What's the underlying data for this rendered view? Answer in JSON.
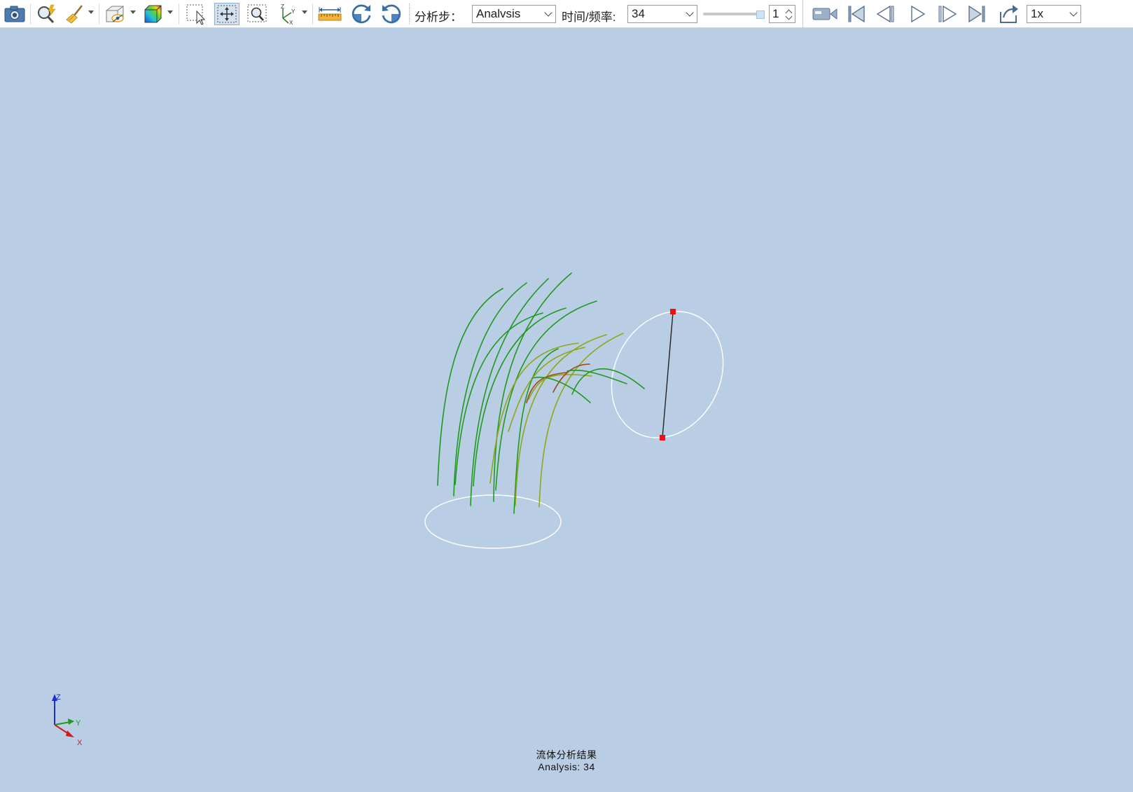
{
  "toolbar": {
    "icons": [
      {
        "name": "camera-icon"
      },
      {
        "name": "query-icon"
      },
      {
        "name": "broom-icon"
      },
      {
        "name": "visibility-icon"
      },
      {
        "name": "contour-icon"
      },
      {
        "name": "select-icon"
      },
      {
        "name": "pan-icon"
      },
      {
        "name": "zoom-window-icon"
      },
      {
        "name": "axes-icon"
      },
      {
        "name": "ruler-icon"
      },
      {
        "name": "rotate-cw-icon"
      },
      {
        "name": "rotate-ccw-icon"
      }
    ],
    "step_label": "分析步：",
    "step_value": "Analvsis",
    "time_label": "时间/频率:",
    "time_value": "34",
    "spin_value": "1",
    "speed_value": "1x"
  },
  "playback": {
    "icons": [
      "record-icon",
      "first-frame-icon",
      "prev-frame-icon",
      "play-icon",
      "next-frame-icon",
      "last-frame-icon",
      "export-icon"
    ]
  },
  "viewport": {
    "background": "#b9cee4",
    "streamline_color": "#1e9a1e",
    "accent_colors": [
      "#8fa617",
      "#a0461b"
    ],
    "axes": {
      "z": "Z",
      "y": "Y",
      "x": "X"
    },
    "caption_title": "流体分析结果",
    "caption_subtitle": "Analysis: 34"
  }
}
